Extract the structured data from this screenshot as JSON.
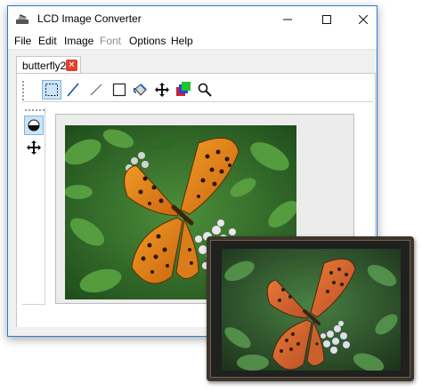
{
  "window": {
    "title": "LCD Image Converter",
    "controls": {
      "minimize": "—",
      "maximize": "☐",
      "close": "✕"
    }
  },
  "menu": {
    "items": [
      {
        "label": "File",
        "enabled": true
      },
      {
        "label": "Edit",
        "enabled": true
      },
      {
        "label": "Image",
        "enabled": true
      },
      {
        "label": "Font",
        "enabled": false
      },
      {
        "label": "Options",
        "enabled": true
      },
      {
        "label": "Help",
        "enabled": true
      }
    ]
  },
  "tabs": [
    {
      "label": "butterfly2",
      "close_icon": "close-icon"
    }
  ],
  "toolbar": {
    "tools": [
      {
        "name": "select-rect-icon",
        "active": true
      },
      {
        "name": "line-icon",
        "active": false
      },
      {
        "name": "line-thin-icon",
        "active": false
      },
      {
        "name": "rectangle-icon",
        "active": false
      },
      {
        "name": "fill-bucket-icon",
        "active": false
      },
      {
        "name": "move-icon",
        "active": false
      },
      {
        "name": "color-layers-icon",
        "active": false
      },
      {
        "name": "zoom-icon",
        "active": false
      }
    ]
  },
  "side_tools": [
    {
      "name": "pen-icon",
      "active": true
    },
    {
      "name": "move-icon",
      "active": false
    }
  ],
  "colors": {
    "accent": "#2b79d4",
    "tab_close": "#e0402c",
    "butterfly_orange": "#e8871e",
    "foliage_green": "#3f7f2e"
  }
}
